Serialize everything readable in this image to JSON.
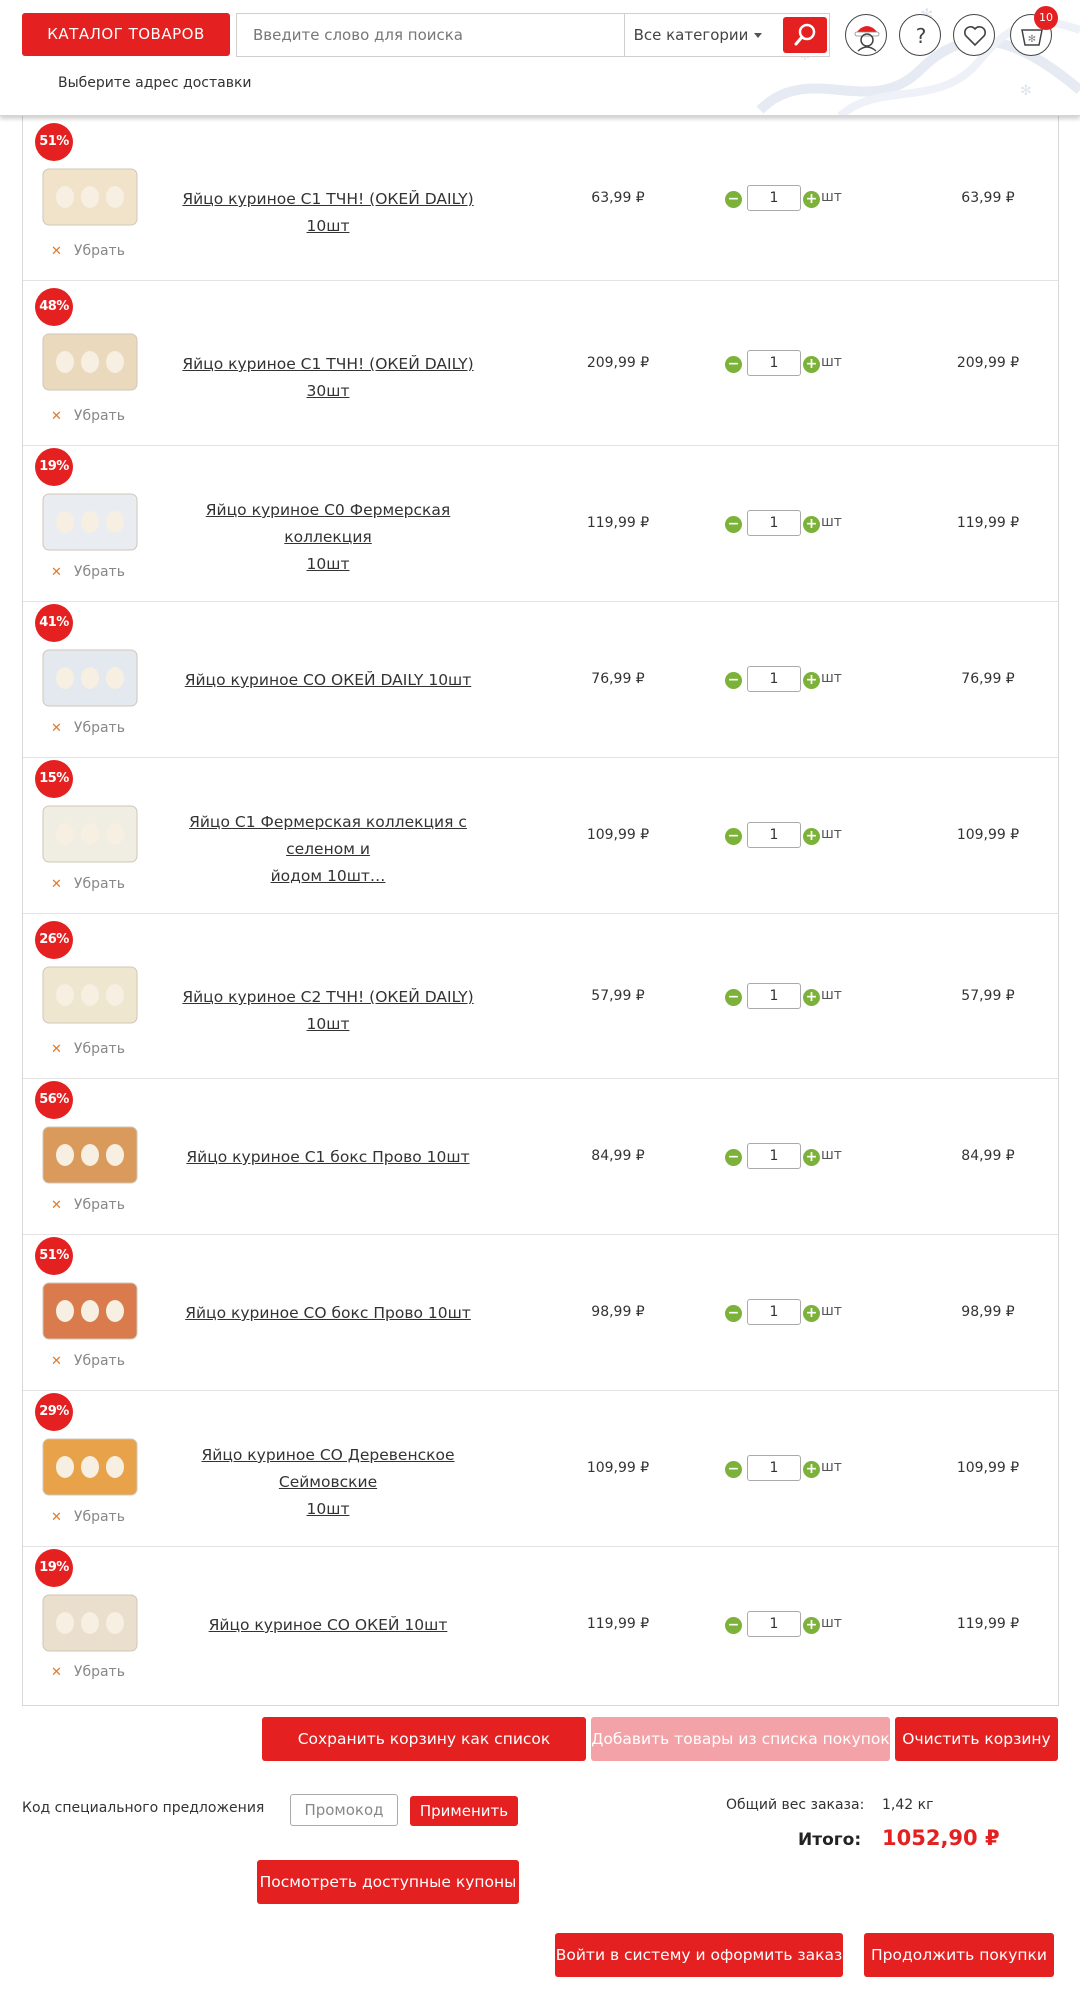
{
  "header": {
    "catalog_label": "КАТАЛОГ ТОВАРОВ",
    "search_placeholder": "Введите слово для поиска",
    "category_select": "Все категории",
    "cart_count": "10",
    "delivery_prompt": "Выберите адрес доставки"
  },
  "cart": {
    "remove_label": "Убрать",
    "unit_label": "шт",
    "items": [
      {
        "discount": "51%",
        "title_line1": "Яйцо куриное С1 ТЧН! (ОКЕЙ DAILY) 10шт",
        "title_line2": "",
        "price": "63,99 ₽",
        "qty": "1",
        "total": "63,99 ₽"
      },
      {
        "discount": "48%",
        "title_line1": "Яйцо куриное С1 ТЧН! (ОКЕЙ DAILY) 30шт",
        "title_line2": "",
        "price": "209,99 ₽",
        "qty": "1",
        "total": "209,99 ₽"
      },
      {
        "discount": "19%",
        "title_line1": "Яйцо куриное С0 Фермерская коллекция",
        "title_line2": "10шт",
        "price": "119,99 ₽",
        "qty": "1",
        "total": "119,99 ₽"
      },
      {
        "discount": "41%",
        "title_line1": "Яйцо куриное СО ОКЕЙ DAILY 10шт",
        "title_line2": "",
        "price": "76,99 ₽",
        "qty": "1",
        "total": "76,99 ₽"
      },
      {
        "discount": "15%",
        "title_line1": "Яйцо С1 Фермерская коллекция с селеном и",
        "title_line2": "йодом 10шт…",
        "price": "109,99 ₽",
        "qty": "1",
        "total": "109,99 ₽"
      },
      {
        "discount": "26%",
        "title_line1": "Яйцо куриное С2 ТЧН! (ОКЕЙ DAILY) 10шт",
        "title_line2": "",
        "price": "57,99 ₽",
        "qty": "1",
        "total": "57,99 ₽"
      },
      {
        "discount": "56%",
        "title_line1": "Яйцо куриное С1 бокс Прово 10шт",
        "title_line2": "",
        "price": "84,99 ₽",
        "qty": "1",
        "total": "84,99 ₽"
      },
      {
        "discount": "51%",
        "title_line1": "Яйцо куриное СО бокс Прово 10шт",
        "title_line2": "",
        "price": "98,99 ₽",
        "qty": "1",
        "total": "98,99 ₽"
      },
      {
        "discount": "29%",
        "title_line1": "Яйцо куриное СО Деревенское Сеймовские",
        "title_line2": "10шт",
        "price": "109,99 ₽",
        "qty": "1",
        "total": "109,99 ₽"
      },
      {
        "discount": "19%",
        "title_line1": "Яйцо куриное СО ОКЕЙ 10шт",
        "title_line2": "",
        "price": "119,99 ₽",
        "qty": "1",
        "total": "119,99 ₽"
      }
    ]
  },
  "actions": {
    "save_list": "Сохранить корзину как список покупок",
    "add_from_list": "Добавить товары из списка покупок",
    "clear_cart": "Очистить корзину"
  },
  "promo": {
    "label": "Код специального предложения",
    "placeholder": "Промокод",
    "apply": "Применить",
    "coupons": "Посмотреть доступные купоны"
  },
  "summary": {
    "weight_label": "Общий вес заказа:",
    "weight_value": "1,42 кг",
    "total_label": "Итого:",
    "total_value": "1052,90 ₽"
  },
  "checkout": {
    "login_order": "Войти в систему и оформить заказ",
    "continue": "Продолжить покупки"
  },
  "colors": {
    "brand_red": "#e42020",
    "pale_red": "#f3a3a8",
    "qty_green": "#7cb23a",
    "remove_orange": "#e07a2c"
  }
}
